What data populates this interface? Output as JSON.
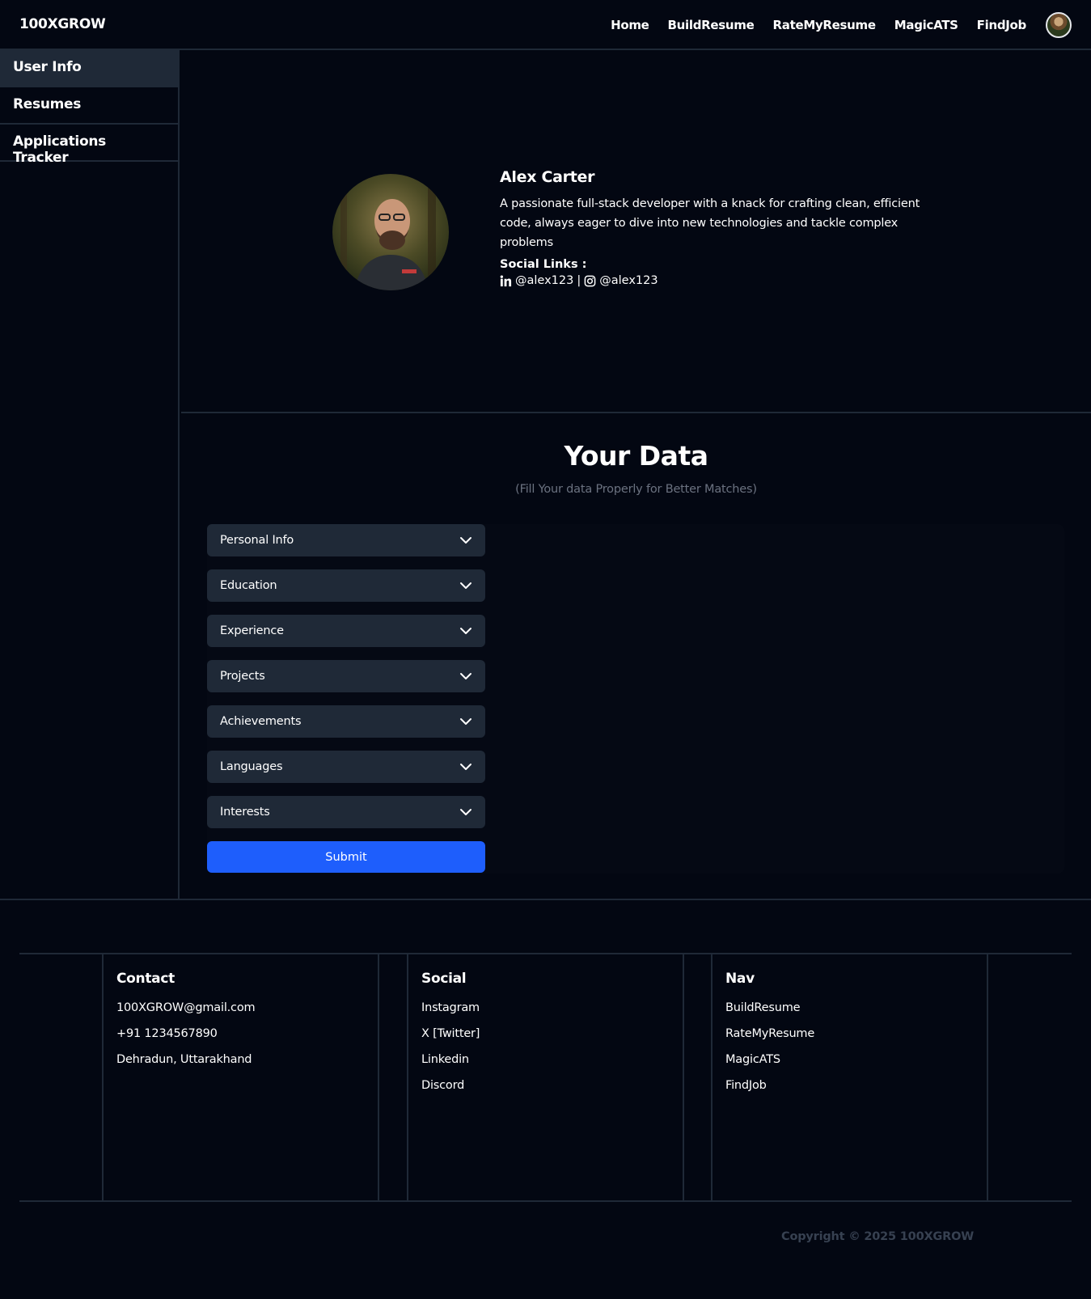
{
  "nav": {
    "brand": "100XGROW",
    "links": [
      "Home",
      "BuildResume",
      "RateMyResume",
      "MagicATS",
      "FindJob"
    ]
  },
  "sidebar": {
    "items": [
      "User Info",
      "Resumes",
      "Applications Tracker"
    ],
    "active": "User Info"
  },
  "profile": {
    "name": "Alex Carter",
    "bio": "A passionate full-stack developer with a knack for crafting clean, efficient code, always eager to dive into new technologies and tackle complex problems",
    "social_title": "Social Links :",
    "linkedin": "@alex123",
    "separator": "|",
    "instagram": "@alex123"
  },
  "data_section": {
    "title": "Your Data",
    "subtitle": "(Fill Your data Properly for Better Matches)",
    "sections": [
      "Personal Info",
      "Education",
      "Experience",
      "Projects",
      "Achievements",
      "Languages",
      "Interests"
    ],
    "submit_label": "Submit"
  },
  "footer": {
    "contact": {
      "title": "Contact",
      "items": [
        "100XGROW@gmail.com",
        "+91 1234567890",
        "Dehradun, Uttarakhand"
      ]
    },
    "social": {
      "title": "Social",
      "items": [
        "Instagram",
        "X [Twitter]",
        "Linkedin",
        "Discord"
      ]
    },
    "nav": {
      "title": "Nav",
      "items": [
        "BuildResume",
        "RateMyResume",
        "MagicATS",
        "FindJob"
      ]
    },
    "copyright": "Copyright © 2025 100XGROW"
  },
  "colors": {
    "background": "#030712",
    "panel": "#1f2937",
    "accent": "#1e5efc",
    "muted": "#6b7280"
  }
}
